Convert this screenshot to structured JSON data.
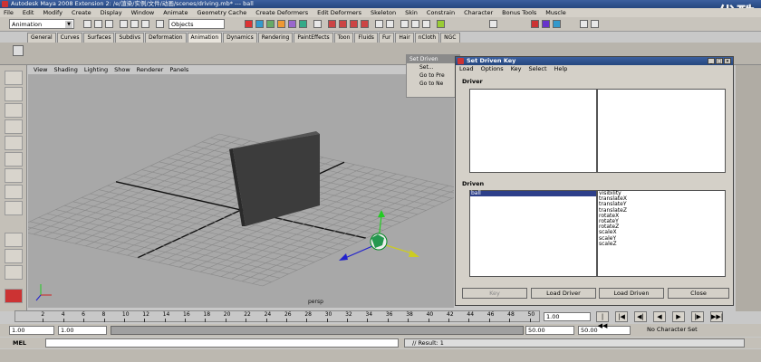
{
  "window": {
    "title": "Autodesk Maya 2008 Extension 2: /e/渲染/实例/文件/动画/scenes/driving.mb* --- ball",
    "watermark": "优酷"
  },
  "menubar": [
    "File",
    "Edit",
    "Modify",
    "Create",
    "Display",
    "Window",
    "Animate",
    "Geometry Cache",
    "Create Deformers",
    "Edit Deformers",
    "Skeleton",
    "Skin",
    "Constrain",
    "Character",
    "Bonus Tools",
    "Muscle"
  ],
  "statusline": {
    "mode": "Animation",
    "objects_field": "Objects"
  },
  "shelf_tabs": [
    "General",
    "Curves",
    "Surfaces",
    "Subdivs",
    "Deformation",
    "Animation",
    "Dynamics",
    "Rendering",
    "PaintEffects",
    "Toon",
    "Fluids",
    "Fur",
    "Hair",
    "nCloth",
    "NGC"
  ],
  "viewport": {
    "menu": [
      "View",
      "Shading",
      "Lighting",
      "Show",
      "Renderer",
      "Panels"
    ],
    "camera_label": "persp"
  },
  "popup_menu": {
    "title": "Set Driven",
    "items": [
      "Set...",
      "Go to Pre",
      "Go to Ne"
    ]
  },
  "set_driven_key": {
    "title": "Set Driven Key",
    "menu": [
      "Load",
      "Options",
      "Key",
      "Select",
      "Help"
    ],
    "driver_label": "Driver",
    "driven_label": "Driven",
    "driven_objects": [
      "ball"
    ],
    "driven_attributes": [
      "visibility",
      "translateX",
      "translateY",
      "translateZ",
      "rotateX",
      "rotateY",
      "rotateZ",
      "scaleX",
      "scaleY",
      "scaleZ"
    ],
    "buttons": {
      "key": "Key",
      "load_driver": "Load Driver",
      "load_driven": "Load Driven",
      "close": "Close"
    }
  },
  "timeslider": {
    "ticks": [
      "2",
      "4",
      "6",
      "8",
      "10",
      "12",
      "14",
      "16",
      "18",
      "20",
      "22",
      "24",
      "26",
      "28",
      "30",
      "32",
      "34",
      "36",
      "38",
      "40",
      "42",
      "44",
      "46",
      "48",
      "50"
    ],
    "current_frame": "1.00"
  },
  "playback": [
    "|◀◀",
    "|◀",
    "◀|",
    "◀",
    "▶",
    "|▶",
    "▶▶|"
  ],
  "range": {
    "start": "1.00",
    "start_playback": "1.00",
    "end_playback": "50.00",
    "end": "50.00",
    "character_set": "No Character Set"
  },
  "commandline": {
    "label": "MEL",
    "result": "// Result: 1"
  },
  "colors": {
    "title_blue": "#25477f",
    "viewport_gray": "#a8a8a8",
    "selection_blue": "#2d3f8a"
  }
}
